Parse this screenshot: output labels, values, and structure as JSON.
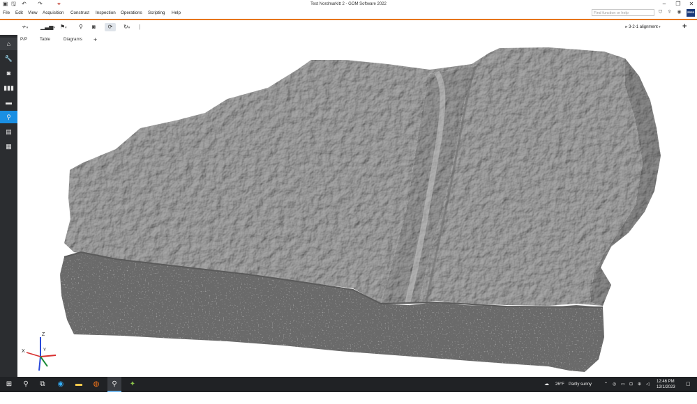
{
  "window": {
    "title": "Test Nordmarkitt 2 - GOM Software 2022",
    "controls": {
      "minimize": "–",
      "maximize": "❐",
      "close": "✕"
    }
  },
  "quick_access": {
    "icons": [
      "app-icon",
      "save-icon",
      "undo-icon",
      "redo-icon",
      "link-icon"
    ]
  },
  "menu": {
    "items": [
      "File",
      "Edit",
      "View",
      "Acquisition",
      "Construct",
      "Inspection",
      "Operations",
      "Scripting",
      "Help"
    ],
    "search_placeholder": "Find function or help",
    "brand": "ZEISS"
  },
  "toolbar": {
    "alignment_label": "3-2-1 alignment",
    "plus": "+"
  },
  "tabs": {
    "items": [
      "P/P",
      "Table",
      "Diagrams"
    ],
    "add": "+"
  },
  "sidebar": {
    "icons": [
      "home-icon",
      "wrench-icon",
      "camera-icon",
      "barcode-icon",
      "video-icon",
      "search-icon",
      "document-icon",
      "qr-icon"
    ],
    "active_index": 5
  },
  "axes": {
    "z": "Z",
    "x": "X",
    "y": "Y"
  },
  "taskbar": {
    "weather_temp": "26°F",
    "weather_desc": "Partly sunny",
    "time": "12:46 PM",
    "date": "12/1/2023"
  },
  "colors": {
    "accent": "#e7760d",
    "sidebar": "#2b2d30",
    "sidebar_active": "#1a8fe3",
    "rock": "#a5a5a5",
    "rock_cut": "#666666"
  }
}
